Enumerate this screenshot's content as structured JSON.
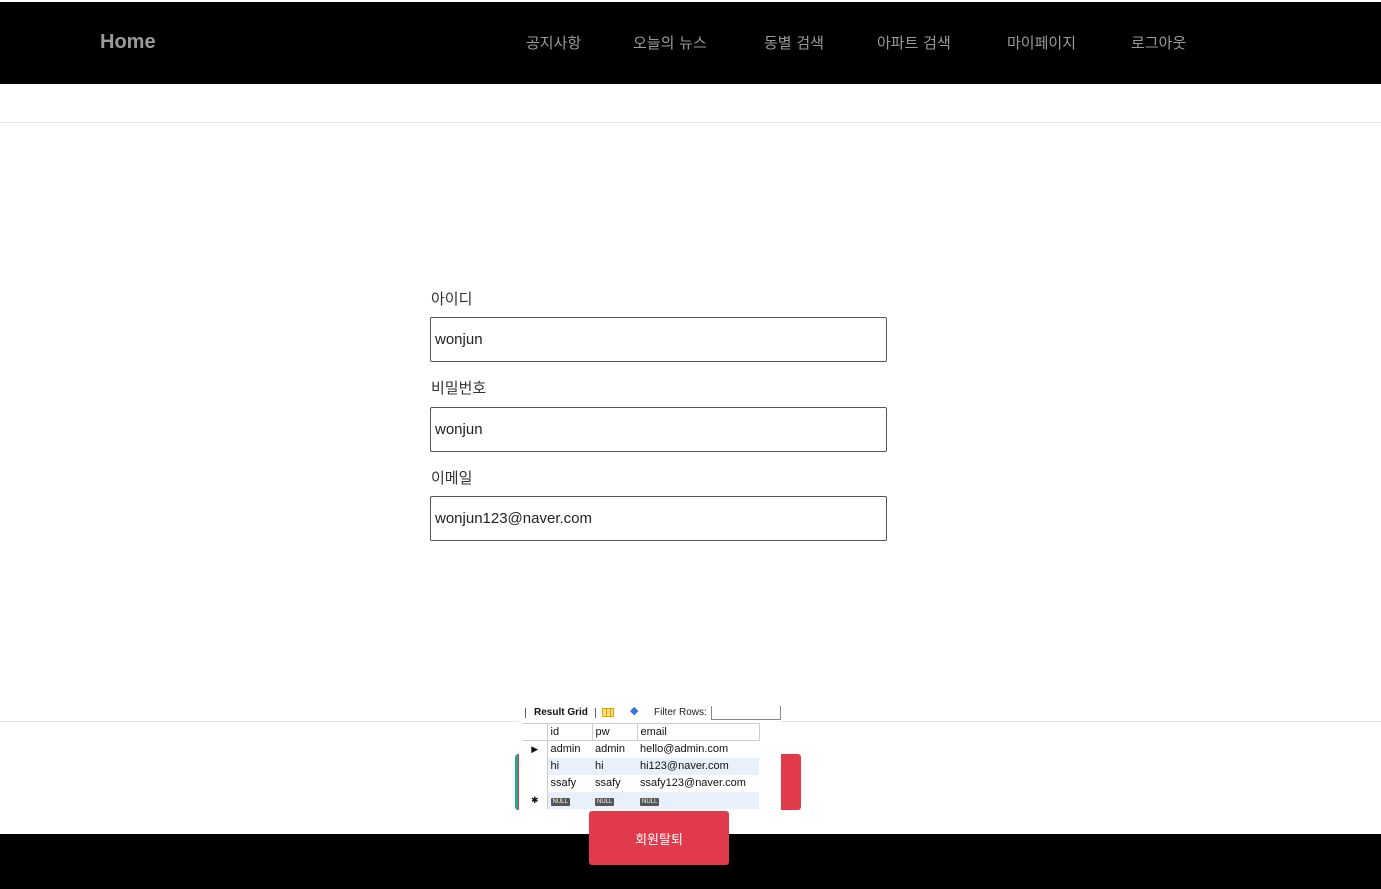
{
  "nav": {
    "brand": "Home",
    "items": [
      "공지사항",
      "오늘의 뉴스",
      "동별 검색",
      "아파트 검색",
      "마이페이지",
      "로그아웃"
    ]
  },
  "form": {
    "id_label": "아이디",
    "id_value": "wonjun",
    "pw_label": "비밀번호",
    "pw_value": "wonjun",
    "email_label": "이메일",
    "email_value": "wonjun123@naver.com"
  },
  "result_grid": {
    "title": "Result Grid",
    "filter_label": "Filter Rows:",
    "columns": [
      "id",
      "pw",
      "email"
    ],
    "rows": [
      [
        "admin",
        "admin",
        "hello@admin.com"
      ],
      [
        "hi",
        "hi",
        "hi123@naver.com"
      ],
      [
        "ssafy",
        "ssafy",
        "ssafy123@naver.com"
      ]
    ],
    "null_text": "NULL"
  },
  "actions": {
    "withdraw_label": "회원탈퇴"
  },
  "colors": {
    "nav_bg": "#000000",
    "nav_text": "#9a9a9a",
    "danger": "#e03a4b"
  }
}
